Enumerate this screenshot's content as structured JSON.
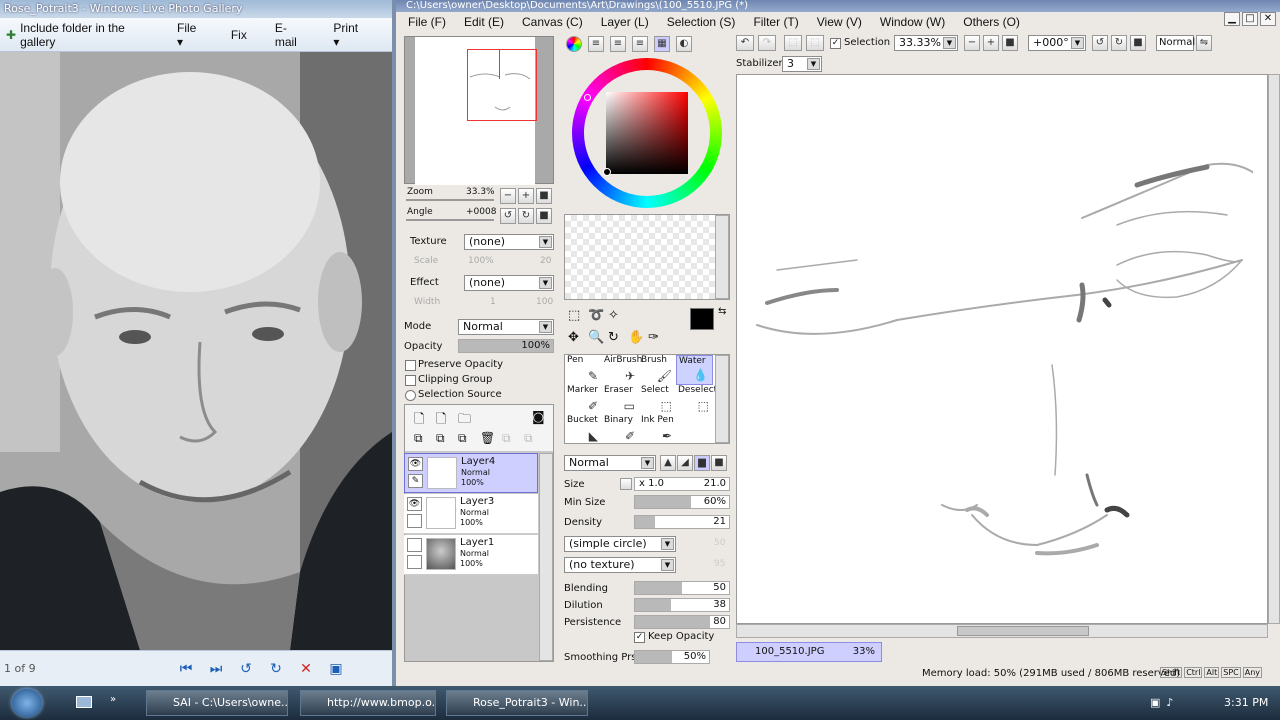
{
  "gallery": {
    "title": "Rose_Potrait3 - Windows Live Photo Gallery",
    "menu": [
      "Include folder in the gallery",
      "File ▾",
      "Fix",
      "E-mail",
      "Print ▾"
    ],
    "counter": "1 of 9"
  },
  "sai": {
    "title": "C:\\Users\\owner\\Desktop\\Documents\\Art\\Drawings\\(100_5510.JPG (*)",
    "menu": [
      "File (F)",
      "Edit (E)",
      "Canvas (C)",
      "Layer (L)",
      "Selection (S)",
      "Filter (T)",
      "View (V)",
      "Window (W)",
      "Others (O)"
    ],
    "navigator": {
      "zoom_label": "Zoom",
      "zoom_value": "33.3%",
      "angle_label": "Angle",
      "angle_value": "+0008"
    },
    "texture": {
      "label": "Texture",
      "value": "(none)",
      "scale_label": "Scale",
      "scale_value": "100%",
      "scale_num": "20"
    },
    "effect": {
      "label": "Effect",
      "value": "(none)",
      "width_label": "Width",
      "width_value": "1",
      "width_num": "100"
    },
    "layer_props": {
      "mode_label": "Mode",
      "mode_value": "Normal",
      "opacity_label": "Opacity",
      "opacity_value": "100%",
      "preserve_opacity": "Preserve Opacity",
      "clipping_group": "Clipping Group",
      "selection_source": "Selection Source"
    },
    "layers": [
      {
        "name": "Layer4",
        "mode": "Normal",
        "opacity": "100%"
      },
      {
        "name": "Layer3",
        "mode": "Normal",
        "opacity": "100%"
      },
      {
        "name": "Layer1",
        "mode": "Normal",
        "opacity": "100%"
      }
    ],
    "tools": [
      {
        "label": "Pen",
        "icon": "pen-icon"
      },
      {
        "label": "AirBrush",
        "icon": "airbrush-icon"
      },
      {
        "label": "Brush",
        "icon": "brush-icon"
      },
      {
        "label": "Water",
        "icon": "water-icon"
      },
      {
        "label": "Marker",
        "icon": "marker-icon"
      },
      {
        "label": "Eraser",
        "icon": "eraser-icon"
      },
      {
        "label": "Select",
        "icon": "select-icon"
      },
      {
        "label": "Deselect",
        "icon": "deselect-icon"
      },
      {
        "label": "Bucket",
        "icon": "bucket-icon"
      },
      {
        "label": "Binary",
        "icon": "binary-icon"
      },
      {
        "label": "Ink Pen",
        "icon": "ink-pen-icon"
      }
    ],
    "brush": {
      "blend_mode": "Normal",
      "size_label": "Size",
      "size_mult": "x 1.0",
      "size_value": "21.0",
      "min_size_label": "Min Size",
      "min_size_value": "60%",
      "density_label": "Density",
      "density_value": "21",
      "shape": "(simple circle)",
      "shape_value": "50",
      "texture": "(no texture)",
      "texture_value": "95",
      "blending_label": "Blending",
      "blending_value": "50",
      "dilution_label": "Dilution",
      "dilution_value": "38",
      "persistence_label": "Persistence",
      "persistence_value": "80",
      "keep_opacity": "Keep Opacity",
      "smoothing_label": "Smoothing Prs",
      "smoothing_value": "50%"
    },
    "toolbar": {
      "selection_label": "Selection",
      "zoom": "33.33%",
      "rotation": "+000°",
      "blend": "Normal",
      "stabilizer_label": "Stabilizer",
      "stabilizer_value": "3"
    },
    "doc_tab": {
      "name": "100_5510.JPG",
      "zoom": "33%"
    },
    "status": {
      "memory": "Memory load: 50% (291MB used / 806MB reserved)",
      "keys": [
        "Shift",
        "Ctrl",
        "Alt",
        "SPC",
        "Any"
      ]
    }
  },
  "taskbar": {
    "items": [
      "SAI - C:\\Users\\owne...",
      "http://www.bmop.o...",
      "Rose_Potrait3 - Win..."
    ],
    "clock": "3:31 PM"
  }
}
